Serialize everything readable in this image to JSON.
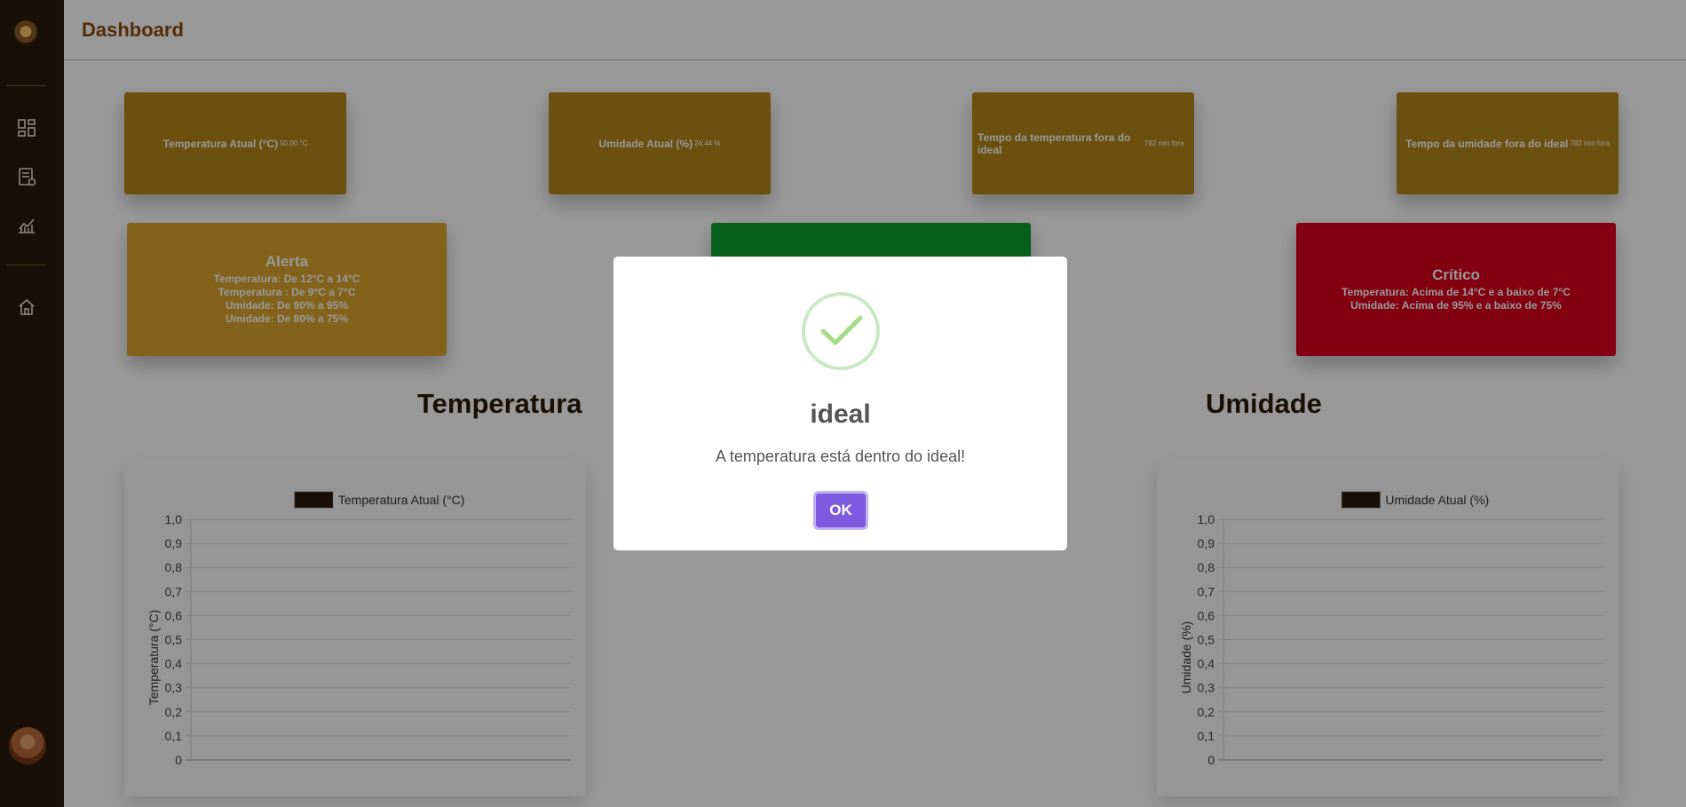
{
  "header": {
    "title": "Dashboard"
  },
  "sidebar": {
    "logo_icon": "logo-icon",
    "items": [
      {
        "name": "dashboard-icon"
      },
      {
        "name": "report-icon"
      },
      {
        "name": "analytics-icon"
      },
      {
        "name": "home-icon"
      }
    ],
    "avatar": "user-avatar"
  },
  "stats": [
    {
      "label": "Temperatura Atual (°C)",
      "value": "50.00 °C"
    },
    {
      "label": "Umidade Atual (%)",
      "value": "24.44 %"
    },
    {
      "label": "Tempo da temperatura fora do ideal",
      "value": "782 min fora"
    },
    {
      "label": "Tempo da umidade fora do ideal",
      "value": "782 min fora"
    }
  ],
  "status_cards": {
    "alert": {
      "title": "Alerta",
      "lines": [
        "Temperatura: De 12°C a 14°C",
        "Temperatura : De 9°C a 7°C",
        "Umidade: De 90% a 95%",
        "Umidade: De 80% a 75%"
      ],
      "color": "#dba42d"
    },
    "ideal": {
      "color": "#0aa12f"
    },
    "critical": {
      "title": "Crítico",
      "lines": [
        "Temperatura: Acima de 14°C e a baixo de 7°C",
        "Umidade: Acima de 95% e a baixo de 75%"
      ],
      "color": "#d9001b"
    }
  },
  "sections": {
    "temperature": "Temperatura",
    "humidity": "Umidade"
  },
  "chart_data": [
    {
      "type": "line",
      "title": "",
      "legend": [
        "Temperatura Atual (°C)"
      ],
      "xlabel": "",
      "ylabel": "Temperatura (°C)",
      "ylim": [
        0,
        1
      ],
      "yticks": [
        "0",
        "0,1",
        "0,2",
        "0,3",
        "0,4",
        "0,5",
        "0,6",
        "0,7",
        "0,8",
        "0,9",
        "1,0"
      ],
      "series": [
        {
          "name": "Temperatura Atual (°C)",
          "values": []
        }
      ],
      "grid": true,
      "legend_position": "top",
      "series_color": "#2c1a0c"
    },
    {
      "type": "line",
      "title": "",
      "legend": [
        "Umidade Atual (%)"
      ],
      "xlabel": "",
      "ylabel": "Umidade (%)",
      "ylim": [
        0,
        1
      ],
      "yticks": [
        "0",
        "0,1",
        "0,2",
        "0,3",
        "0,4",
        "0,5",
        "0,6",
        "0,7",
        "0,8",
        "0,9",
        "1,0"
      ],
      "series": [
        {
          "name": "Umidade Atual (%)",
          "values": []
        }
      ],
      "grid": true,
      "legend_position": "top",
      "series_color": "#2c1a0c"
    }
  ],
  "modal": {
    "icon": "success-check-icon",
    "title": "ideal",
    "text": "A temperatura está dentro do ideal!",
    "ok_label": "OK",
    "accent": "#7e5ae0"
  }
}
